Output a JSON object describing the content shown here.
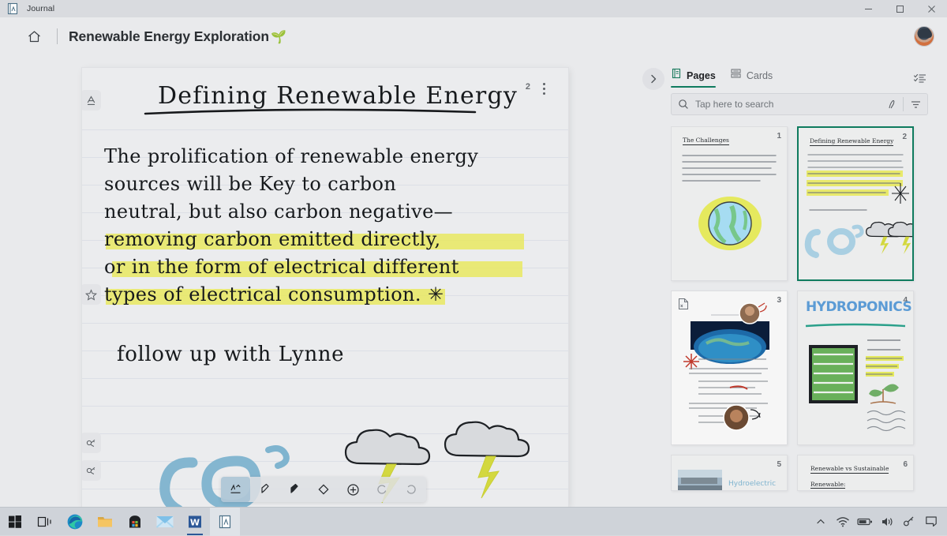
{
  "titlebar": {
    "app_icon": "journal-app-icon",
    "app_name": "Journal",
    "minimize": "—",
    "maximize": "□",
    "close": "✕"
  },
  "header": {
    "home_icon": "home-icon",
    "title": "Renewable Energy Exploration",
    "title_emoji": "🌱",
    "avatar": "user-avatar"
  },
  "canvas": {
    "page_number": "2",
    "more_menu": "more-options-icon",
    "gutter": {
      "title_tag": "A",
      "star_tag": "☆",
      "ink_tag_1": "ink-mark-icon",
      "ink_tag_2": "ink-mark-icon"
    },
    "note_title": "Defining Renewable Energy",
    "body_lines": [
      "The   prolification  of renewable  energy",
      "sources  will  be  Key  to  carbon",
      "neutral, but  also  carbon  negative—",
      "removing  carbon  emitted   directly,",
      "or in the  form  of electrical  different",
      "types  of  electrical  consumption. ✳"
    ],
    "highlighted_lines": [
      3,
      4,
      5
    ],
    "highlight_color": "#e8e85c",
    "note_followup": "follow up with Lynne",
    "drawings": {
      "co2_label": "CO",
      "co2_superscript": "2",
      "cloud_1": "storm-cloud-with-lightning",
      "cloud_2": "storm-cloud-with-lightning"
    }
  },
  "pen_toolbar": {
    "tools": [
      {
        "name": "pen-tool",
        "glyph": "✒",
        "selected": true
      },
      {
        "name": "highlighter-tool",
        "glyph": "◢",
        "selected": false
      },
      {
        "name": "marker-tool",
        "glyph": "◥",
        "selected": false
      },
      {
        "name": "eraser-tool",
        "glyph": "◇",
        "selected": false
      },
      {
        "name": "add-tool",
        "glyph": "⊕",
        "selected": false
      },
      {
        "name": "undo-button",
        "glyph": "↶",
        "selected": false
      },
      {
        "name": "redo-button",
        "glyph": "↷",
        "selected": false
      }
    ]
  },
  "panel": {
    "collapse_icon": "chevron-right-icon",
    "tabs": [
      {
        "label": "Pages",
        "icon": "pages-icon",
        "active": true
      },
      {
        "label": "Cards",
        "icon": "cards-icon",
        "active": false
      }
    ],
    "action_icon": "task-list-icon",
    "search": {
      "placeholder": "Tap here to search",
      "value": "",
      "search_icon": "search-icon",
      "ink_search_icon": "ink-search-icon",
      "filter_icon": "filter-icon"
    },
    "accent_color": "#0f7b5f",
    "thumbnails": [
      {
        "number": "1",
        "title": "The Challenges",
        "selected": false,
        "kind": "handwritten-earth",
        "body_preview": "Scientific consensus is clear the world confronts a rampant carbon problem. The carbon in our atmosphere has created a blanket of gas that traps heat and is changing the world's climate."
      },
      {
        "number": "2",
        "title": "Defining Renewable Energy",
        "selected": true,
        "kind": "handwritten-co2",
        "body_preview": "The prolification of renewable energy sources will be key to carbon neutral, but also carbon negative— removing carbon emitted directly, or in the form of electrical different types of electrical consumption.",
        "footer_note": "follow up with Lynne"
      },
      {
        "number": "3",
        "title": "",
        "selected": false,
        "kind": "pdf-document",
        "doc_icon": "pdf-file-icon"
      },
      {
        "number": "4",
        "title": "HYDROPONICS",
        "selected": false,
        "kind": "hydroponics",
        "bullets": [
          "no soil needed",
          "needs less land",
          "doesn't require pesticides or herbicides"
        ]
      },
      {
        "number": "5",
        "title": "Hydroelectric",
        "selected": false,
        "kind": "hydroelectric-photo"
      },
      {
        "number": "6",
        "title": "Renewable vs Sustainable",
        "selected": false,
        "kind": "handwritten-text",
        "subhead": "Renewable:"
      }
    ]
  },
  "taskbar": {
    "apps": [
      {
        "name": "start-button",
        "label": "Start"
      },
      {
        "name": "task-view-button",
        "label": "Task View"
      },
      {
        "name": "edge-browser-button",
        "label": "Microsoft Edge"
      },
      {
        "name": "file-explorer-button",
        "label": "File Explorer"
      },
      {
        "name": "microsoft-store-button",
        "label": "Microsoft Store"
      },
      {
        "name": "mail-button",
        "label": "Mail"
      },
      {
        "name": "word-button",
        "label": "Word"
      },
      {
        "name": "journal-button",
        "label": "Journal"
      }
    ],
    "tray": [
      {
        "name": "show-hidden-icons-button",
        "label": "^"
      },
      {
        "name": "network-icon",
        "label": "Network"
      },
      {
        "name": "battery-icon",
        "label": "Battery"
      },
      {
        "name": "volume-icon",
        "label": "Volume"
      },
      {
        "name": "pen-menu-icon",
        "label": "Pen menu"
      },
      {
        "name": "action-center-button",
        "label": "Action Center"
      }
    ]
  }
}
